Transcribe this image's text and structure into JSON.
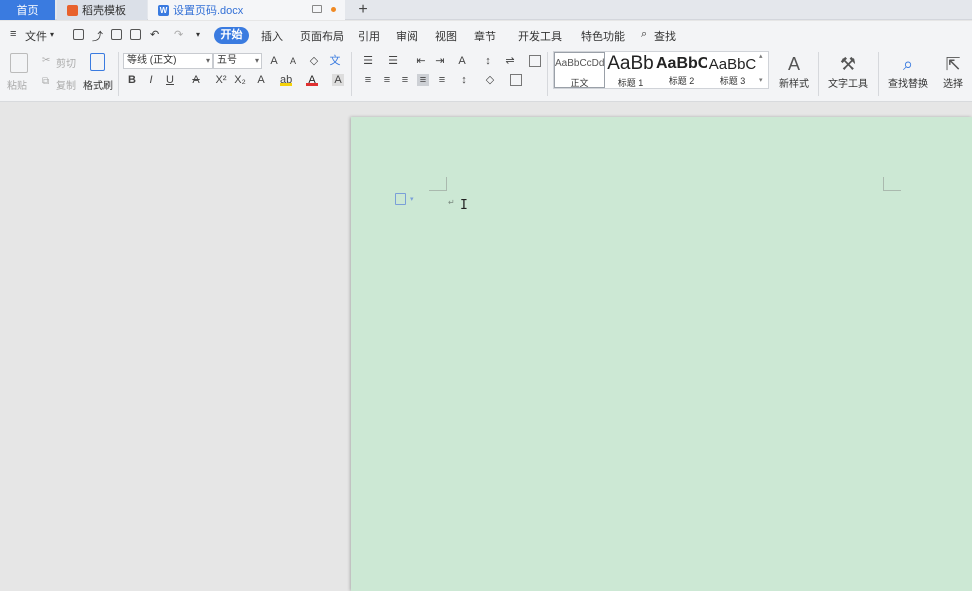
{
  "tabs": {
    "home": "首页",
    "docer": "稻壳模板",
    "document": "设置页码.docx",
    "add": "+"
  },
  "menu": {
    "file": "文件",
    "items": [
      "开始",
      "插入",
      "页面布局",
      "引用",
      "审阅",
      "视图",
      "章节",
      "开发工具",
      "特色功能"
    ],
    "search": "查找"
  },
  "ribbon": {
    "paste": "粘贴",
    "cut": "剪切",
    "copy": "复制",
    "format_painter": "格式刷",
    "font_name": "等线 (正文)",
    "font_size": "五号",
    "styles": [
      {
        "sample": "AaBbCcDd",
        "caption": "正文"
      },
      {
        "sample": "AaBb",
        "caption": "标题 1"
      },
      {
        "sample": "AaBbC",
        "caption": "标题 2"
      },
      {
        "sample": "AaBbC",
        "caption": "标题 3"
      }
    ],
    "new_style": "新样式",
    "text_tools": "文字工具",
    "find_replace": "查找替换",
    "select": "选择"
  },
  "colors": {
    "accent": "#3a7be0",
    "page_bg": "#cce8d4",
    "workspace_bg": "#e6e6e6"
  }
}
